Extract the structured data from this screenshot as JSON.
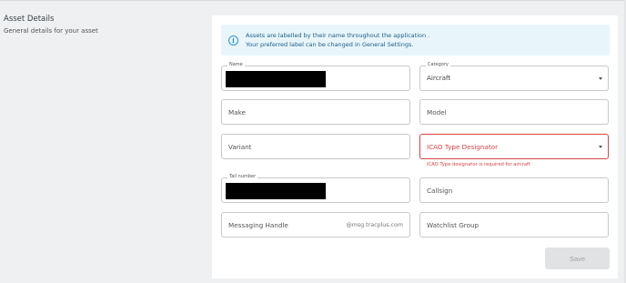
{
  "section": {
    "title": "Asset Details",
    "subtitle": "General details for your asset"
  },
  "info": {
    "line1": "Assets are labelled by their name throughout the application .",
    "line2": "Your preferred label can be changed in General Settings."
  },
  "fields": {
    "name": {
      "label": "Name",
      "value": ""
    },
    "category": {
      "label": "Category",
      "value": "Aircraft"
    },
    "make": {
      "placeholder": "Make"
    },
    "model": {
      "placeholder": "Model"
    },
    "variant": {
      "placeholder": "Variant"
    },
    "icao": {
      "placeholder": "ICAO Type Designator",
      "error": "ICAO Type designator is required for aircraft"
    },
    "tail": {
      "label": "Tail number",
      "value": ""
    },
    "callsign": {
      "placeholder": "Callsign"
    },
    "messaging": {
      "placeholder": "Messaging Handle",
      "suffix": "@msg.tracplus.com"
    },
    "watchlist": {
      "placeholder": "Watchlist Group"
    }
  },
  "save_label": "Save",
  "icons": {
    "info": "info-icon",
    "dropdown": "chevron-down-icon"
  },
  "colors": {
    "error": "#d64545",
    "info_bg": "#e8f6fc",
    "accent": "#2f8fd1"
  }
}
